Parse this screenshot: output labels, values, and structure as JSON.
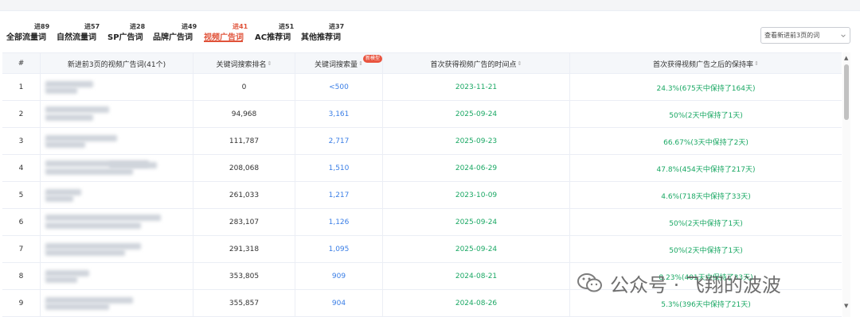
{
  "tabs": [
    {
      "label": "全部流量词",
      "badge": "进89",
      "active": false
    },
    {
      "label": "自然流量词",
      "badge": "进57",
      "active": false
    },
    {
      "label": "SP广告词",
      "badge": "进28",
      "active": false
    },
    {
      "label": "品牌广告词",
      "badge": "进49",
      "active": false
    },
    {
      "label": "视频广告词",
      "badge": "进41",
      "active": true
    },
    {
      "label": "AC推荐词",
      "badge": "进51",
      "active": false
    },
    {
      "label": "其他推荐词",
      "badge": "进37",
      "active": false
    }
  ],
  "filter": {
    "selected": "查看新进前3页的词",
    "icon": "chevron-down-icon"
  },
  "table": {
    "headers": {
      "index": "#",
      "keyword": "新进前3页的视频广告词(41个)",
      "rank": "关键词搜索排名",
      "volume": "关键词搜索量",
      "volume_badge": "新模型",
      "first_time": "首次获得视频广告的时间点",
      "retention": "首次获得视频广告之后的保持率"
    },
    "sort_icon": "⇕",
    "rows": [
      {
        "index": "1",
        "rank": "0",
        "volume": "<500",
        "date": "2023-11-21",
        "rate": "24.3%(675天中保持了164天)"
      },
      {
        "index": "2",
        "rank": "94,968",
        "volume": "3,161",
        "date": "2025-09-24",
        "rate": "50%(2天中保持了1天)"
      },
      {
        "index": "3",
        "rank": "111,787",
        "volume": "2,717",
        "date": "2025-09-23",
        "rate": "66.67%(3天中保持了2天)"
      },
      {
        "index": "4",
        "rank": "208,068",
        "volume": "1,510",
        "date": "2024-06-29",
        "rate": "47.8%(454天中保持了217天)"
      },
      {
        "index": "5",
        "rank": "261,033",
        "volume": "1,217",
        "date": "2023-10-09",
        "rate": "4.6%(718天中保持了33天)"
      },
      {
        "index": "6",
        "rank": "283,107",
        "volume": "1,126",
        "date": "2025-09-24",
        "rate": "50%(2天中保持了1天)"
      },
      {
        "index": "7",
        "rank": "291,318",
        "volume": "1,095",
        "date": "2025-09-24",
        "rate": "50%(2天中保持了1天)"
      },
      {
        "index": "8",
        "rank": "353,805",
        "volume": "909",
        "date": "2024-08-21",
        "rate": "8.23%(401天中保持了33天)"
      },
      {
        "index": "9",
        "rank": "355,857",
        "volume": "904",
        "date": "2024-08-26",
        "rate": "5.3%(396天中保持了21天)"
      }
    ]
  },
  "scrollbar": {
    "up": "▲",
    "down": "▼"
  },
  "watermark": {
    "text": "公众号 · 飞翔的波波",
    "icon": "wechat-icon"
  },
  "colors": {
    "accent": "#e0533a",
    "link": "#3a7ee6",
    "positive": "#1aa864",
    "border": "#ebeef5",
    "header_bg": "#f5f7fa"
  }
}
